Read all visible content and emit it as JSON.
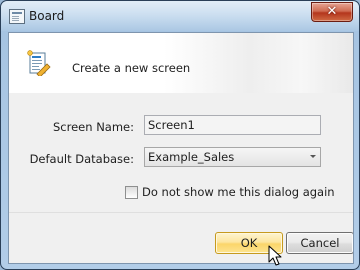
{
  "window": {
    "title": "Board",
    "close_glyph": "✕",
    "app_icon": "dialog-window-icon"
  },
  "header": {
    "text": "Create a new screen",
    "icon": "new-screen-document-icon"
  },
  "form": {
    "screen_name_label": "Screen Name:",
    "screen_name_value": "Screen1",
    "database_label": "Default Database:",
    "database_value": "Example_Sales",
    "checkbox_label": "Do not show me this dialog again",
    "checkbox_checked": false
  },
  "buttons": {
    "ok": "OK",
    "cancel": "Cancel"
  },
  "colors": {
    "ok_button": "#fbd56a",
    "title_bar": "#b2cde8",
    "close_button": "#c24a30"
  }
}
